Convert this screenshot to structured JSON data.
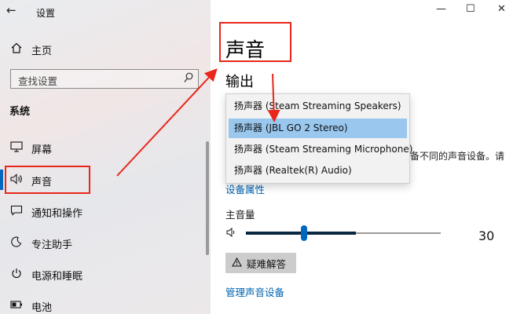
{
  "window": {
    "back_glyph": "←",
    "app_title": "设置",
    "controls": {
      "minimize": "—",
      "maximize": "☐",
      "close": "✕"
    }
  },
  "sidebar": {
    "home_label": "主页",
    "search_placeholder": "查找设置",
    "section_title": "系统",
    "items": [
      {
        "label": "屏幕",
        "icon": "monitor-icon"
      },
      {
        "label": "声音",
        "icon": "speaker-icon",
        "active": true
      },
      {
        "label": "通知和操作",
        "icon": "notification-icon"
      },
      {
        "label": "专注助手",
        "icon": "moon-icon"
      },
      {
        "label": "电源和睡眠",
        "icon": "power-icon"
      },
      {
        "label": "电池",
        "icon": "battery-icon"
      }
    ]
  },
  "main": {
    "page_title": "声音",
    "output_title": "输出",
    "output_devices": [
      "扬声器 (Steam Streaming Speakers)",
      "扬声器 (JBL GO 2 Stereo)",
      "扬声器 (Steam Streaming Microphone)",
      "扬声器 (Realtek(R) Audio)"
    ],
    "selected_device_index": 1,
    "partial_description": "备不同的声音设备。请",
    "device_properties_link": "设备属性",
    "master_volume_label": "主音量",
    "volume_value": "30",
    "volume_level": 0.3,
    "troubleshoot_label": "疑难解答",
    "manage_devices_link": "管理声音设备"
  },
  "colors": {
    "accent": "#0067c0",
    "link": "#0063b1",
    "annotation_red": "#e8261a",
    "selected_item": "#99c7ee"
  }
}
